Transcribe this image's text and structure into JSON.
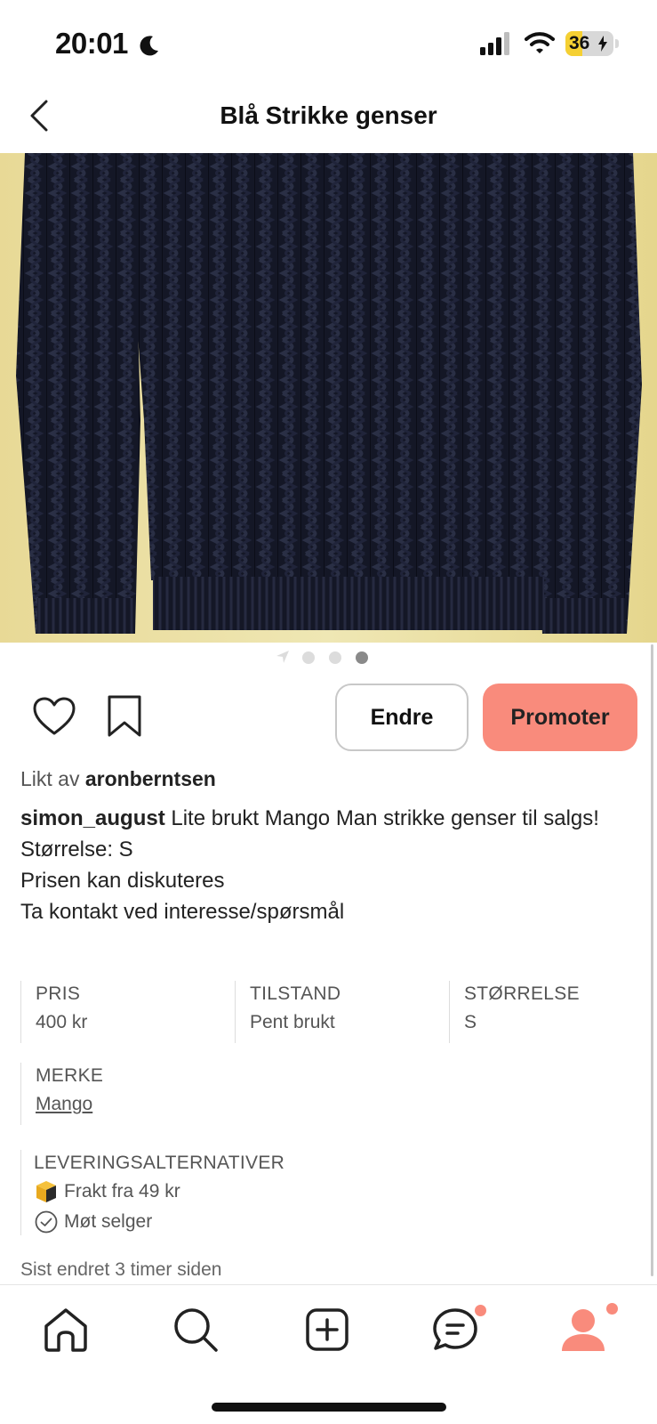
{
  "status_bar": {
    "time": "20:01",
    "battery": "36"
  },
  "header": {
    "title": "Blå Strikke genser"
  },
  "carousel": {
    "count": 3,
    "active_index": 2
  },
  "actions": {
    "edit_label": "Endre",
    "promote_label": "Promoter"
  },
  "liked": {
    "prefix": "Likt av",
    "user": "aronberntsen"
  },
  "description": {
    "user": "simon_august",
    "text": "Lite brukt Mango Man strikke genser til salgs!",
    "lines": [
      "Størrelse: S",
      "Prisen kan diskuteres",
      "Ta kontakt ved interesse/spørsmål"
    ]
  },
  "details": {
    "price": {
      "label": "PRIS",
      "value": "400 kr"
    },
    "condition": {
      "label": "TILSTAND",
      "value": "Pent brukt"
    },
    "size": {
      "label": "STØRRELSE",
      "value": "S"
    },
    "brand": {
      "label": "MERKE",
      "value": "Mango"
    }
  },
  "delivery": {
    "label": "LEVERINGSALTERNATIVER",
    "shipping": "Frakt fra 49 kr",
    "meet": "Møt selger"
  },
  "updated": "Sist endret 3 timer siden",
  "colors": {
    "accent": "#f98b7c",
    "badge": "#f98b7c"
  },
  "nav": {
    "items": [
      "home-icon",
      "search-icon",
      "add-icon",
      "chat-icon",
      "profile-icon"
    ]
  }
}
